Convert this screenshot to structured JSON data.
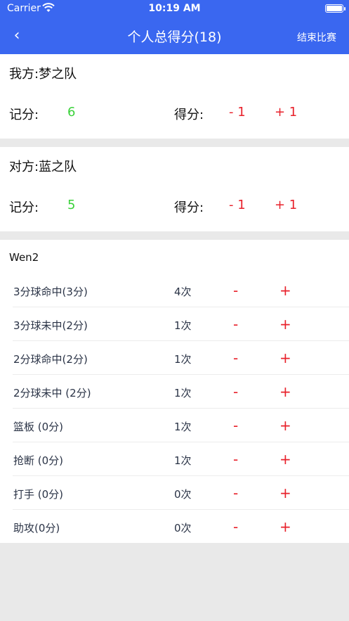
{
  "status_bar": {
    "carrier": "Carrier",
    "time": "10:19 AM"
  },
  "nav": {
    "back": "‹",
    "title": "个人总得分(18)",
    "end_game": "结束比赛"
  },
  "teams": [
    {
      "name": "我方:梦之队",
      "record_label": "记分:",
      "record_value": "6",
      "score_label": "得分:",
      "minus": "- 1",
      "plus": "+ 1"
    },
    {
      "name": "对方:蓝之队",
      "record_label": "记分:",
      "record_value": "5",
      "score_label": "得分:",
      "minus": "- 1",
      "plus": "+ 1"
    }
  ],
  "player": {
    "name": "Wen2",
    "stats": [
      {
        "label": "3分球命中(3分)",
        "count": "4次",
        "minus": "-",
        "plus": "+"
      },
      {
        "label": "3分球未中(2分)",
        "count": "1次",
        "minus": "-",
        "plus": "+"
      },
      {
        "label": "2分球命中(2分)",
        "count": "1次",
        "minus": "-",
        "plus": "+"
      },
      {
        "label": "2分球未中 (2分)",
        "count": "1次",
        "minus": "-",
        "plus": "+"
      },
      {
        "label": "篮板 (0分)",
        "count": "1次",
        "minus": "-",
        "plus": "+"
      },
      {
        "label": "抢断 (0分)",
        "count": "1次",
        "minus": "-",
        "plus": "+"
      },
      {
        "label": "打手 (0分)",
        "count": "0次",
        "minus": "-",
        "plus": "+"
      },
      {
        "label": "助攻(0分)",
        "count": "0次",
        "minus": "-",
        "plus": "+"
      }
    ]
  },
  "colors": {
    "header": "#3a67f0",
    "accent_red": "#e8212b",
    "score_green": "#3ad23a",
    "background": "#e9e9e9"
  }
}
